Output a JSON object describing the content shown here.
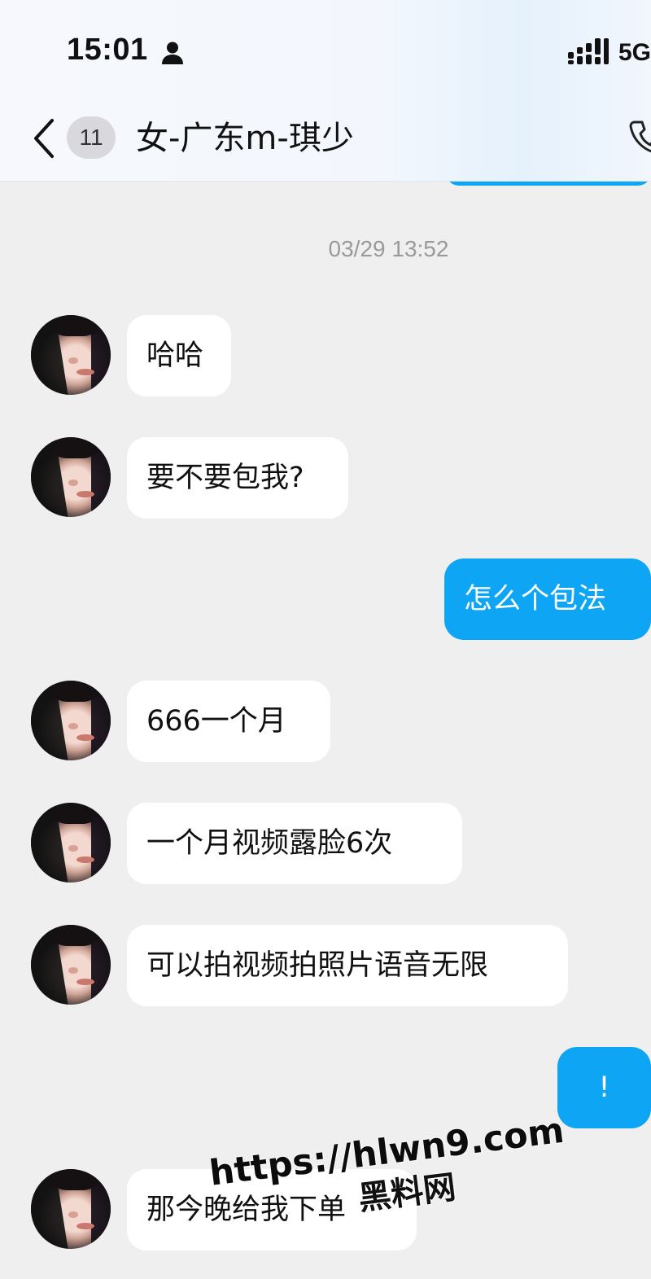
{
  "status_bar": {
    "time": "15:01",
    "network": "5G"
  },
  "header": {
    "unread_count": "11",
    "title": "女-广东m-琪少"
  },
  "chat": {
    "timestamp": "03/29 13:52",
    "messages": [
      {
        "side": "left",
        "text": "哈哈"
      },
      {
        "side": "left",
        "text": "要不要包我?"
      },
      {
        "side": "right",
        "text": "怎么个包法"
      },
      {
        "side": "left",
        "text": "666一个月"
      },
      {
        "side": "left",
        "text": "一个月视频露脸6次"
      },
      {
        "side": "left",
        "text": "可以拍视频拍照片语音无限"
      },
      {
        "side": "right",
        "text": "!"
      },
      {
        "side": "left",
        "text": "那今晚给我下单"
      }
    ]
  },
  "watermark": {
    "url": "https://hlwn9.com",
    "name": "黑料网"
  },
  "colors": {
    "accent": "#0ea5f4",
    "background": "#efefef",
    "bubble_left": "#ffffff"
  },
  "icons": {
    "back": "back-chevron-icon",
    "person": "person-icon",
    "signal": "signal-icon",
    "phone": "phone-icon"
  }
}
